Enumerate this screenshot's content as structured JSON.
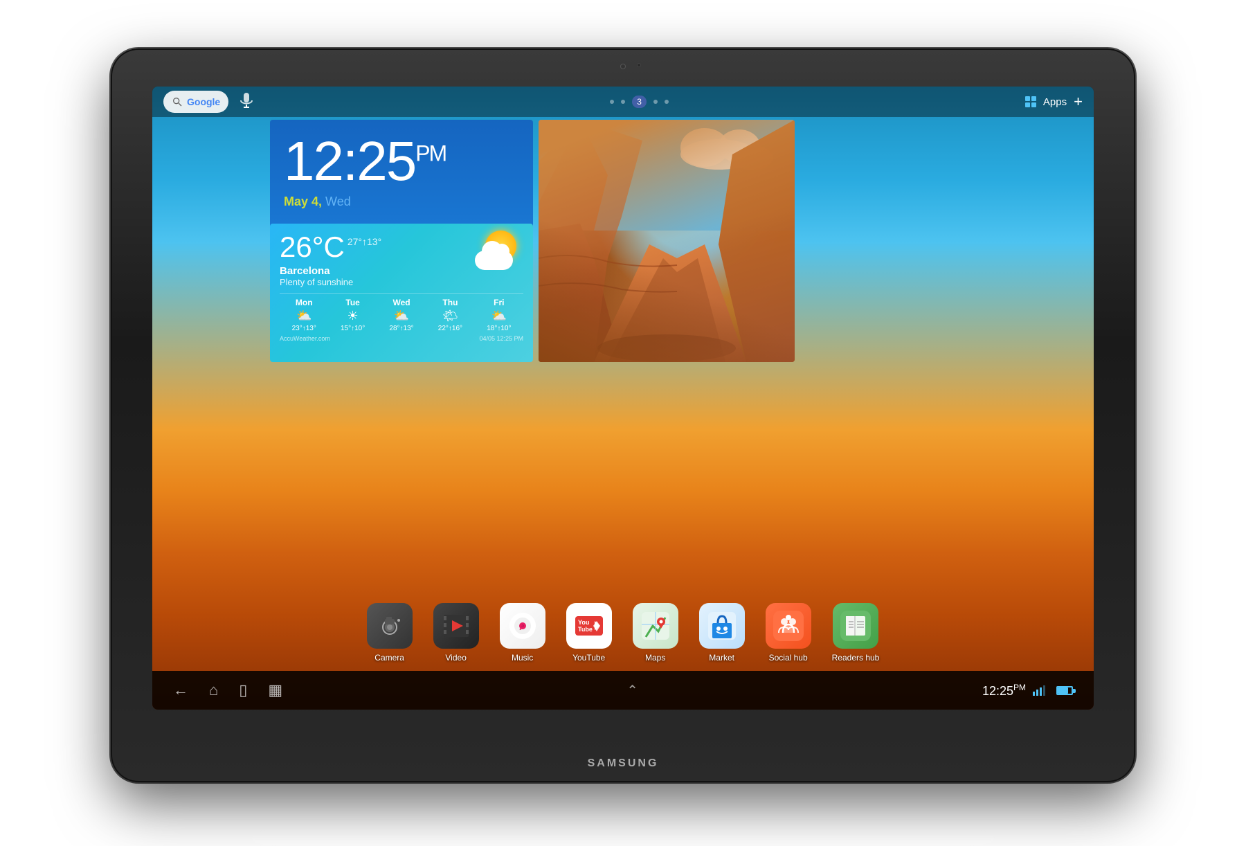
{
  "tablet": {
    "brand": "SAMSUNG"
  },
  "status_bar": {
    "search_placeholder": "Google",
    "mic_label": "🎙",
    "page_dots": [
      1,
      2,
      3,
      4,
      5
    ],
    "active_dot": 3,
    "page_number": "3",
    "apps_label": "Apps",
    "add_label": "+"
  },
  "clock_widget": {
    "time": "12:25",
    "ampm": "PM",
    "date_month_day": "May 4,",
    "date_weekday": "Wed"
  },
  "weather_widget": {
    "temp": "26°C",
    "temp_range": "27°↑13°",
    "city": "Barcelona",
    "description": "Plenty of sunshine",
    "forecast": [
      {
        "day": "Mon",
        "temp": "23°↑13°"
      },
      {
        "day": "Tue",
        "temp": "15°↑10°"
      },
      {
        "day": "Wed",
        "temp": "28°↑13°"
      },
      {
        "day": "Thu",
        "temp": "22°↑16°"
      },
      {
        "day": "Fri",
        "temp": "18°↑10°"
      }
    ],
    "source": "AccuWeather.com",
    "updated": "04/05 12:25 PM"
  },
  "dock": {
    "apps": [
      {
        "name": "Camera",
        "icon": "camera"
      },
      {
        "name": "Video",
        "icon": "video"
      },
      {
        "name": "Music",
        "icon": "music"
      },
      {
        "name": "YouTube",
        "icon": "youtube"
      },
      {
        "name": "Maps",
        "icon": "maps"
      },
      {
        "name": "Market",
        "icon": "market"
      },
      {
        "name": "Social hub",
        "icon": "social"
      },
      {
        "name": "Readers hub",
        "icon": "readers"
      }
    ]
  },
  "nav_bar": {
    "time": "12:25",
    "ampm": "PM"
  }
}
